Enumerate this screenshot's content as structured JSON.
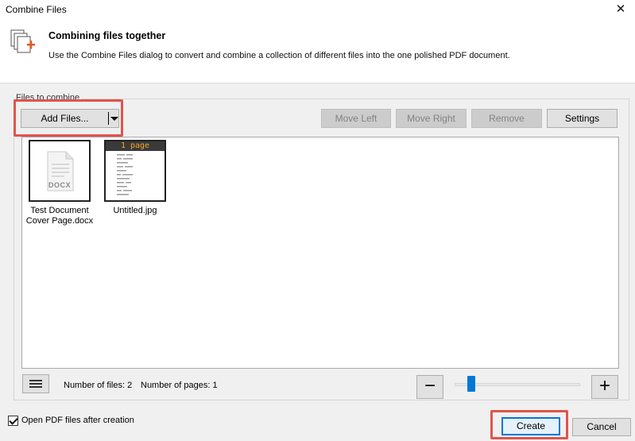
{
  "window": {
    "title": "Combine Files",
    "close_glyph": "✕"
  },
  "header": {
    "title": "Combining files together",
    "description": "Use the Combine Files dialog to convert and combine a collection of different files into the one polished PDF document."
  },
  "group": {
    "label": "Files to combine"
  },
  "toolbar": {
    "add_files": "Add Files...",
    "move_left": "Move Left",
    "move_right": "Move Right",
    "remove": "Remove",
    "settings": "Settings"
  },
  "files": [
    {
      "name_line1": "Test Document",
      "name_line2": "Cover Page.docx",
      "type_label": "DOCX",
      "icon": "docx-file-icon"
    },
    {
      "name_line1": "Untitled.jpg",
      "page_badge": "1 page",
      "icon": "image-thumbnail"
    }
  ],
  "stats": {
    "files_label": "Number of files: 2",
    "pages_label": "Number of pages: 1"
  },
  "zoom": {
    "minus": "−",
    "plus": "+",
    "level_fraction": 0.1
  },
  "footer": {
    "open_after_label": "Open PDF files after creation",
    "open_after_checked": true,
    "create": "Create",
    "cancel": "Cancel"
  },
  "colors": {
    "highlight": "#e0544c",
    "accent": "#0078d7",
    "badge_text": "#f5a623"
  }
}
